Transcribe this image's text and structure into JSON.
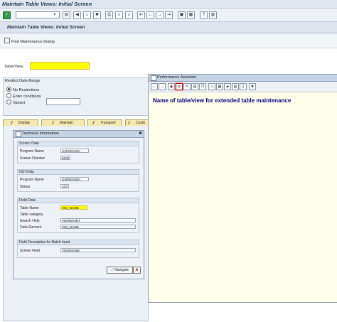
{
  "window": {
    "title": "Maintain Table Views: Initial Screen"
  },
  "system_toolbar": {
    "icons": [
      "check-icon",
      "save-icon",
      "back-icon",
      "exit-icon",
      "cancel-icon",
      "print-icon",
      "find-icon",
      "find-next-icon",
      "first-page-icon",
      "prev-page-icon",
      "next-page-icon",
      "last-page-icon",
      "new-session-icon",
      "shortcut-icon",
      "help-icon",
      "layout-icon"
    ]
  },
  "app": {
    "title": "Maintain Table Views: Initial Screen",
    "find_dialog": "Find Maintenance Dialog"
  },
  "table_view": {
    "label": "Table/View",
    "value": ""
  },
  "restrict": {
    "title": "Restrict Data Range",
    "options": [
      {
        "label": "No Restrictions",
        "selected": true
      },
      {
        "label": "Enter conditions",
        "selected": false
      },
      {
        "label": "Variant",
        "selected": false
      }
    ],
    "variant_value": ""
  },
  "tabs": [
    {
      "label": "Display"
    },
    {
      "label": "Maintain"
    },
    {
      "label": "Transport"
    },
    {
      "label": "Custo"
    }
  ],
  "tech_info": {
    "title": "Technical Information",
    "screen_data": {
      "heading": "Screen Data",
      "program_label": "Program Name",
      "program_value": "SAPMSVMA",
      "screen_number_label": "Screen Number",
      "screen_number_value": "0100"
    },
    "gui_data": {
      "heading": "GUI Data",
      "program_label": "Program Name",
      "program_value": "SAPMSVMA",
      "status_label": "Status",
      "status_value": "100"
    },
    "field_data": {
      "heading": "Field Data",
      "table_name_label": "Table Name",
      "table_name_value": "VIM_NAME",
      "table_category_label": "Table category",
      "search_help_label": "Search Help",
      "search_help_value": "VIEWMAINT",
      "data_element_label": "Data Element",
      "data_element_value": "VIM_NAME"
    },
    "batch": {
      "heading": "Field Description for Batch Input",
      "screen_field_label": "Screen Field",
      "screen_field_value": "VIEWNAME"
    },
    "navigate_label": "Navigate",
    "cancel_symbol": "✖"
  },
  "performance_assistant": {
    "title": "Performance Assistant",
    "content": "Name of table/view for extended table maintenance"
  }
}
